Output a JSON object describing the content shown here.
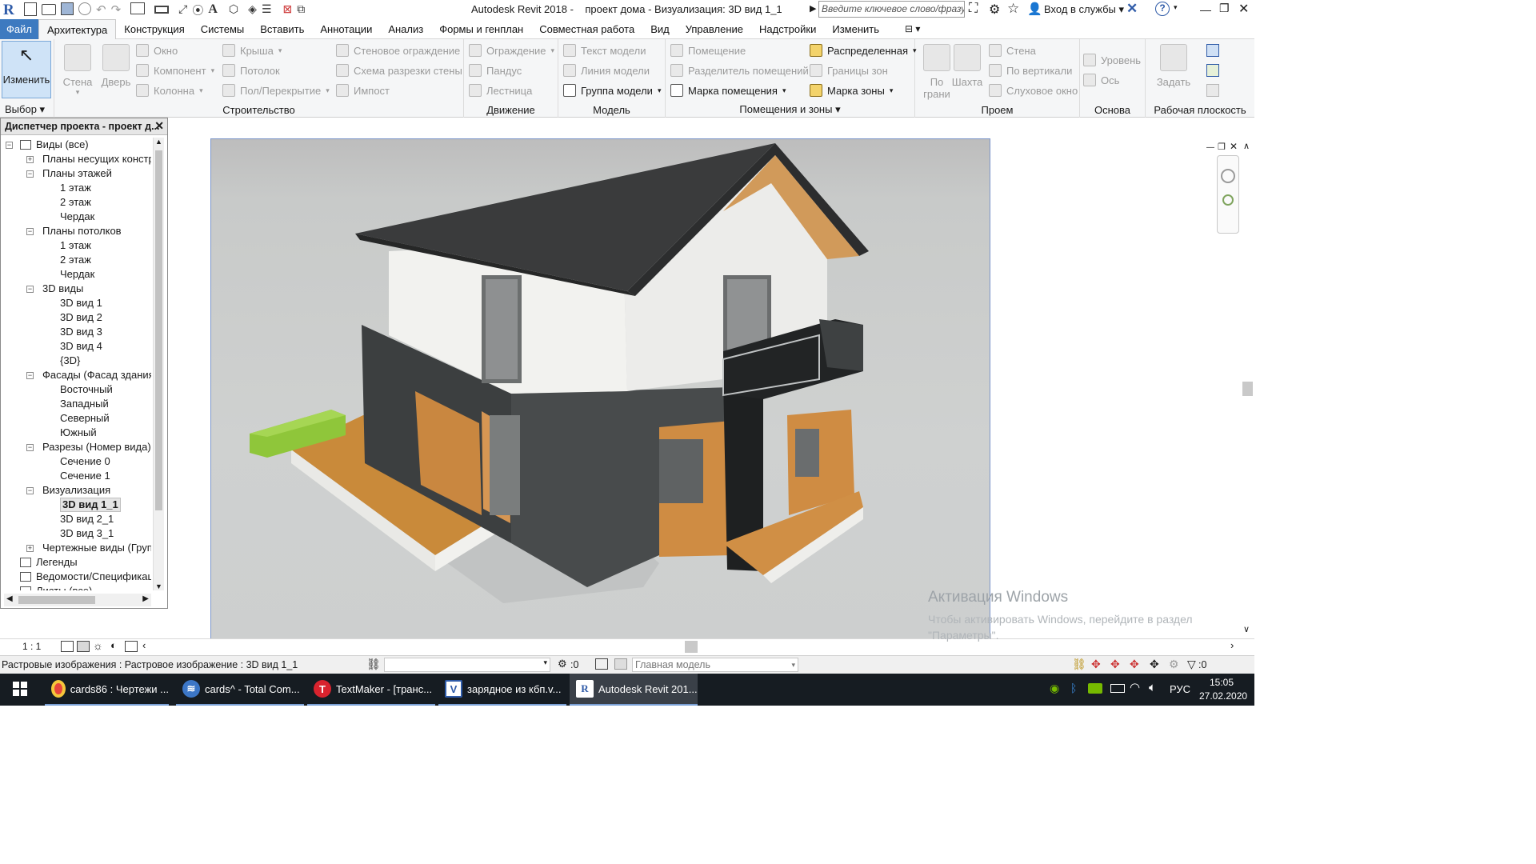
{
  "window": {
    "app_title": "Autodesk Revit 2018 -",
    "doc_title": "проект дома - Визуализация: 3D вид 1_1",
    "search_placeholder": "Введите ключевое слово/фразу",
    "signin": "Вход в службы",
    "help": "?"
  },
  "ribbon_tabs": [
    "Файл",
    "Архитектура",
    "Конструкция",
    "Системы",
    "Вставить",
    "Аннотации",
    "Анализ",
    "Формы и генплан",
    "Совместная работа",
    "Вид",
    "Управление",
    "Надстройки",
    "Изменить"
  ],
  "ribbon": {
    "select": {
      "modify": "Изменить",
      "label": "Выбор"
    },
    "build": {
      "label": "Строительство",
      "wall": "Стена",
      "door": "Дверь",
      "window": "Окно",
      "component": "Компонент",
      "column": "Колонна",
      "roof": "Крыша",
      "ceiling": "Потолок",
      "floor": "Пол/Перекрытие",
      "curtain_system": "Стеновое ограждение",
      "curtain_grid": "Схема разрезки стены",
      "mullion": "Импост"
    },
    "circulation": {
      "label": "Движение",
      "railing": "Ограждение",
      "ramp": "Пандус",
      "stair": "Лестница"
    },
    "model": {
      "label": "Модель",
      "model_text": "Текст модели",
      "model_line": "Линия модели",
      "model_group": "Группа модели"
    },
    "rooms": {
      "label": "Помещения и зоны",
      "room": "Помещение",
      "room_separator": "Разделитель помещений",
      "room_tag": "Марка помещения",
      "area": "Распределенная",
      "area_boundary": "Границы зон",
      "area_tag": "Марка зоны"
    },
    "opening": {
      "label": "Проем",
      "by_face": "По грани",
      "shaft": "Шахта",
      "wall": "Стена",
      "vertical": "По вертикали",
      "dormer": "Слуховое окно"
    },
    "datum": {
      "label": "Основа",
      "level": "Уровень",
      "grid": "Ось"
    },
    "workplane": {
      "label": "Рабочая плоскость",
      "set": "Задать"
    }
  },
  "project_browser": {
    "title": "Диспетчер проекта - проект д...",
    "items": [
      {
        "label": "Виды (все)",
        "indent": 0,
        "toggle": "-"
      },
      {
        "label": "Планы несущих констру",
        "indent": 1,
        "toggle": "+"
      },
      {
        "label": "Планы этажей",
        "indent": 1,
        "toggle": "-"
      },
      {
        "label": "1 этаж",
        "indent": 2,
        "toggle": ""
      },
      {
        "label": "2 этаж",
        "indent": 2,
        "toggle": ""
      },
      {
        "label": "Чердак",
        "indent": 2,
        "toggle": ""
      },
      {
        "label": "Планы потолков",
        "indent": 1,
        "toggle": "-"
      },
      {
        "label": "1 этаж",
        "indent": 2,
        "toggle": ""
      },
      {
        "label": "2 этаж",
        "indent": 2,
        "toggle": ""
      },
      {
        "label": "Чердак",
        "indent": 2,
        "toggle": ""
      },
      {
        "label": "3D виды",
        "indent": 1,
        "toggle": "-"
      },
      {
        "label": "3D вид 1",
        "indent": 2,
        "toggle": ""
      },
      {
        "label": "3D вид 2",
        "indent": 2,
        "toggle": ""
      },
      {
        "label": "3D вид 3",
        "indent": 2,
        "toggle": ""
      },
      {
        "label": "3D вид 4",
        "indent": 2,
        "toggle": ""
      },
      {
        "label": "{3D}",
        "indent": 2,
        "toggle": ""
      },
      {
        "label": "Фасады (Фасад здания)",
        "indent": 1,
        "toggle": "-"
      },
      {
        "label": "Восточный",
        "indent": 2,
        "toggle": ""
      },
      {
        "label": "Западный",
        "indent": 2,
        "toggle": ""
      },
      {
        "label": "Северный",
        "indent": 2,
        "toggle": ""
      },
      {
        "label": "Южный",
        "indent": 2,
        "toggle": ""
      },
      {
        "label": "Разрезы (Номер вида)",
        "indent": 1,
        "toggle": "-"
      },
      {
        "label": "Сечение 0",
        "indent": 2,
        "toggle": ""
      },
      {
        "label": "Сечение 1",
        "indent": 2,
        "toggle": ""
      },
      {
        "label": "Визуализация",
        "indent": 1,
        "toggle": "-"
      },
      {
        "label": "3D вид 1_1",
        "indent": 2,
        "toggle": "",
        "selected": true
      },
      {
        "label": "3D вид 2_1",
        "indent": 2,
        "toggle": ""
      },
      {
        "label": "3D вид 3_1",
        "indent": 2,
        "toggle": ""
      },
      {
        "label": "Чертежные виды (Групп",
        "indent": 1,
        "toggle": "+"
      },
      {
        "label": "Легенды",
        "indent": 0,
        "toggle": ""
      },
      {
        "label": "Ведомости/Спецификац",
        "indent": 0,
        "toggle": ""
      },
      {
        "label": "Листы (все)",
        "indent": 0,
        "toggle": ""
      }
    ]
  },
  "view": {
    "scale": "1 : 1"
  },
  "status": {
    "message": "Растровые изображения : Растровое изображение : 3D вид 1_1",
    "worksets_count": ":0",
    "design_option": "Главная модель",
    "filter_count": ":0"
  },
  "watermark": {
    "title": "Активация Windows",
    "text": "Чтобы активировать Windows, перейдите в раздел \"Параметры\"."
  },
  "taskbar": {
    "items": [
      {
        "label": "cards86 : Чертежи ...",
        "icon": "chrome-icon",
        "color": "#e8453c"
      },
      {
        "label": "cards^ - Total Com...",
        "icon": "total-commander-icon",
        "color": "#3c76c6"
      },
      {
        "label": "TextMaker - [транс...",
        "icon": "textmaker-icon",
        "color": "#d9232e"
      },
      {
        "label": "зарядное из кбп.v...",
        "icon": "visio-icon",
        "color": "#2f5ba8"
      },
      {
        "label": "Autodesk Revit 201...",
        "icon": "revit-icon",
        "color": "#2f5ba8"
      }
    ],
    "lang": "РУС",
    "time": "15:05",
    "date": "27.02.2020"
  },
  "colors": {
    "accent": "#3d7ac0",
    "taskbar": "#161c22"
  }
}
